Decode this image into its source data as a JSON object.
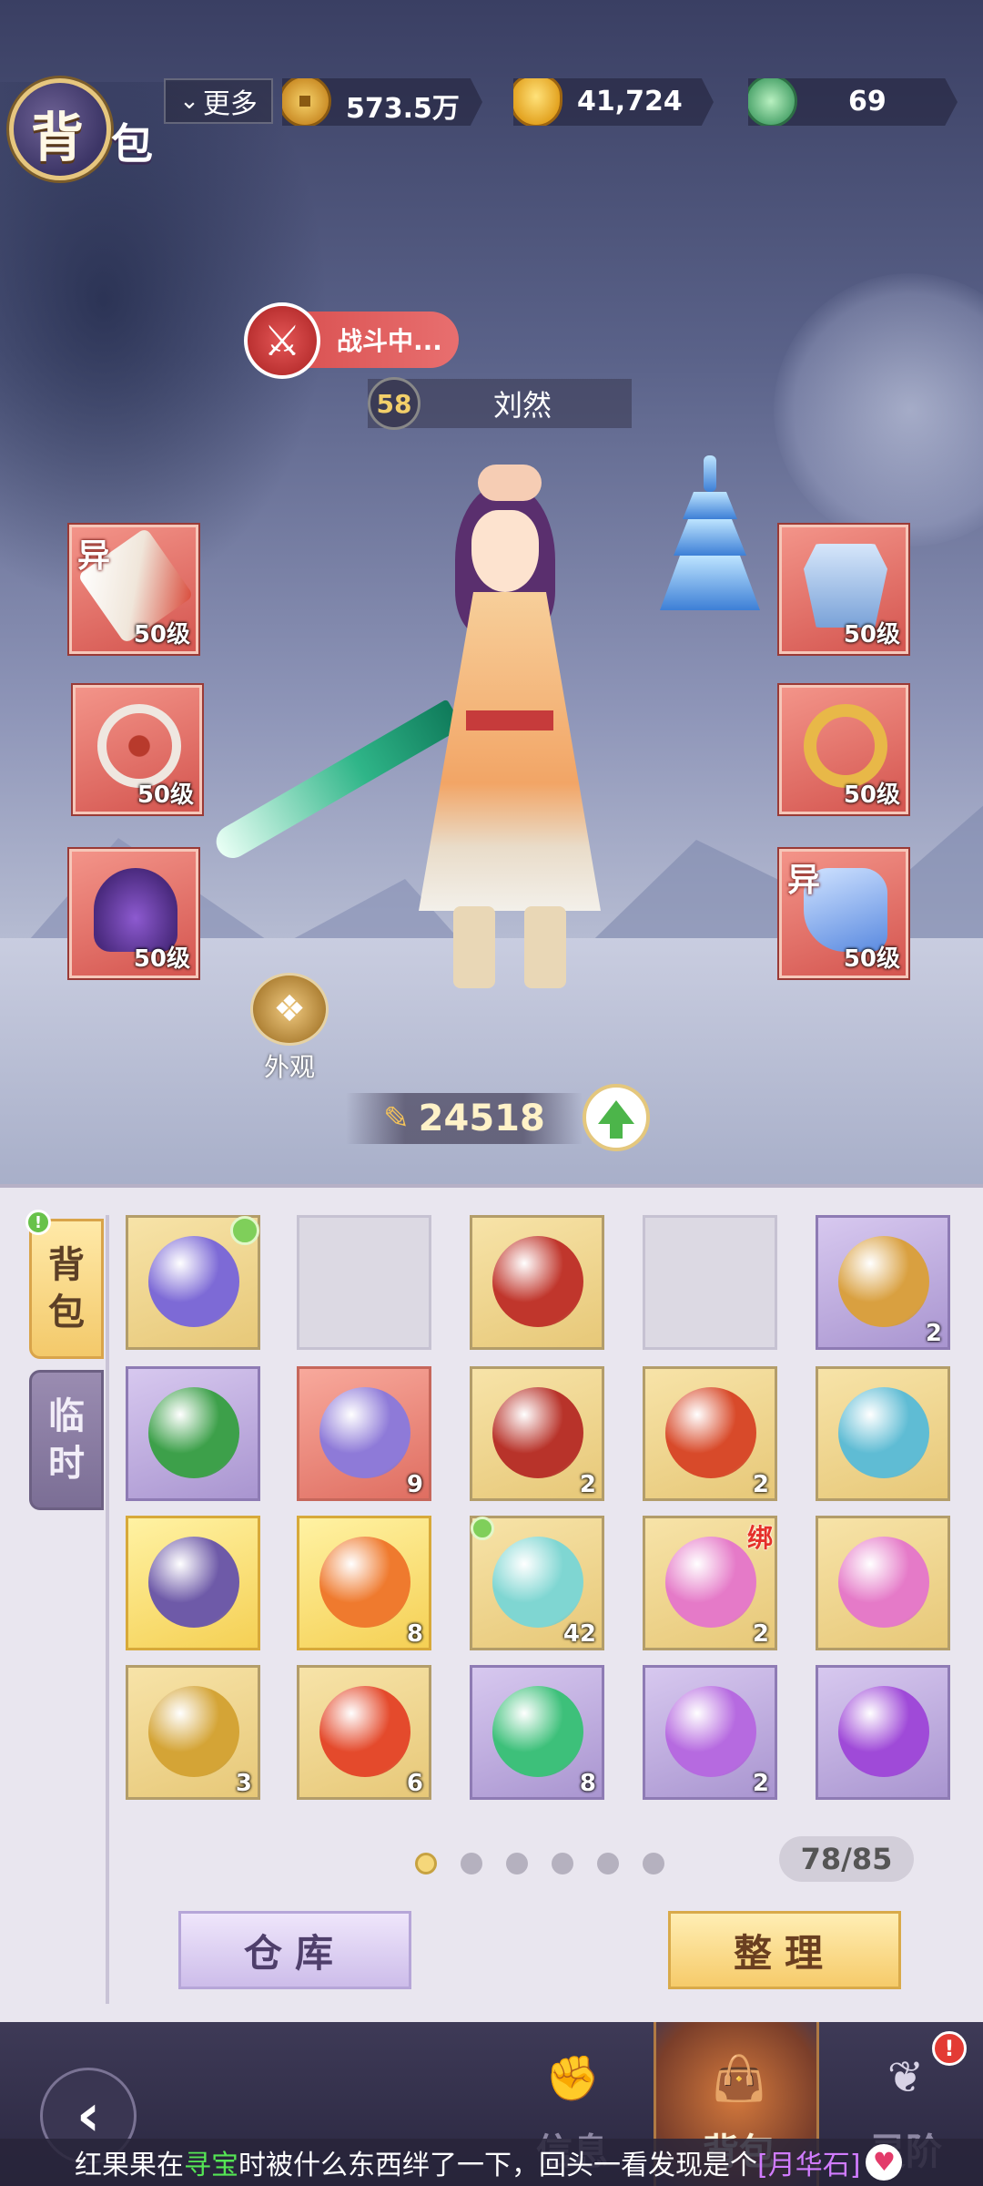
{
  "header": {
    "title_char1": "背",
    "title_char2": "包",
    "more_label": "更多",
    "more_icon": "chevron-down-icon",
    "currencies": [
      {
        "name": "copper-coin",
        "icon": "coin-icon",
        "value": "573.5万"
      },
      {
        "name": "gold-ingot",
        "icon": "ingot-icon",
        "value": "41,724"
      },
      {
        "name": "jade",
        "icon": "jade-dragon-icon",
        "value": "69"
      }
    ]
  },
  "character": {
    "status": "战斗中...",
    "status_icon": "crossed-swords-icon",
    "level": "58",
    "name": "刘然",
    "appearance_label": "外观",
    "power": "24518"
  },
  "equipment": {
    "left": [
      {
        "icon": "sword-icon",
        "level": "50级",
        "tag": "异",
        "color": "#f0e6da"
      },
      {
        "icon": "necklace-icon",
        "level": "50级",
        "tag": "",
        "color": "#b83a2c"
      },
      {
        "icon": "helmet-icon",
        "level": "50级",
        "tag": "",
        "color": "#6a3fa6"
      }
    ],
    "right": [
      {
        "icon": "armor-icon",
        "level": "50级",
        "tag": "",
        "color": "#8cb4e6"
      },
      {
        "icon": "ring-icon",
        "level": "50级",
        "tag": "",
        "color": "#e8b848"
      },
      {
        "icon": "boots-icon",
        "level": "50级",
        "tag": "异",
        "color": "#6aa0e8"
      }
    ]
  },
  "bag": {
    "tabs": [
      {
        "label_1": "背",
        "label_2": "包",
        "active": true,
        "badge": "!"
      },
      {
        "label_1": "临",
        "label_2": "时",
        "active": false
      }
    ],
    "items": [
      {
        "bg": "gold",
        "icon": "card-pack-icon",
        "count": "",
        "color": "#7d6ad6",
        "dot": true
      },
      {
        "bg": "empty",
        "icon": "",
        "count": ""
      },
      {
        "bg": "gold",
        "icon": "treasure-chest-icon",
        "count": "",
        "color": "#c0362c"
      },
      {
        "bg": "empty",
        "icon": "",
        "count": ""
      },
      {
        "bg": "purple",
        "icon": "fate-token-icon",
        "count": "2",
        "color": "#d9a040"
      },
      {
        "bg": "purple",
        "icon": "gift-book-icon",
        "count": "",
        "color": "#3da04a"
      },
      {
        "bg": "red",
        "icon": "scroll-icon",
        "count": "9",
        "color": "#8e7ad8"
      },
      {
        "bg": "gold",
        "icon": "taiji-book-icon",
        "count": "2",
        "color": "#b8332a"
      },
      {
        "bg": "gold",
        "icon": "red-orb-icon",
        "count": "2",
        "color": "#d84a2a"
      },
      {
        "bg": "gold",
        "icon": "cyan-orb-icon",
        "count": "",
        "color": "#5fbcd4"
      },
      {
        "bg": "yellow",
        "icon": "three-orbs-icon",
        "count": "",
        "color": "#6e5aa8"
      },
      {
        "bg": "yellow",
        "icon": "fire-orb-icon",
        "count": "8",
        "color": "#ef7a2e"
      },
      {
        "bg": "gold",
        "icon": "potion-icon",
        "count": "42",
        "color": "#7fd6d2",
        "dot_left": true
      },
      {
        "bg": "gold",
        "icon": "peach-icon",
        "count": "2",
        "color": "#e57ac8",
        "bind": "绑"
      },
      {
        "bg": "gold",
        "icon": "peach-icon",
        "count": "",
        "color": "#e57ac8"
      },
      {
        "bg": "gold",
        "icon": "gold-ore-icon",
        "count": "3",
        "color": "#d4a436"
      },
      {
        "bg": "gold",
        "icon": "phoenix-feather-icon",
        "count": "6",
        "color": "#e44a2c"
      },
      {
        "bg": "purple",
        "icon": "jade-orb-icon",
        "count": "8",
        "color": "#3dc07a"
      },
      {
        "bg": "purple",
        "icon": "gem-icon",
        "count": "2",
        "color": "#b66ae0"
      },
      {
        "bg": "purple",
        "icon": "purple-orb-icon",
        "count": "",
        "color": "#9f4ad8"
      }
    ],
    "pages": 6,
    "current_page": 1,
    "capacity": "78/85",
    "storage_label": "仓库",
    "sort_label": "整理"
  },
  "nav": {
    "back_icon": "back-arrow-icon",
    "items": [
      {
        "icon": "fist-icon",
        "label": "信息",
        "active": false
      },
      {
        "icon": "bag-icon",
        "label": "背包",
        "active": true
      },
      {
        "icon": "flame-icon",
        "label": "灵阶",
        "active": false,
        "badge": "!"
      }
    ]
  },
  "ticker": {
    "part1": "红果果在",
    "highlight": "寻宝",
    "part2": "时被什么东西绊了一下，回头一看发现是个",
    "item": "[月华石]"
  }
}
